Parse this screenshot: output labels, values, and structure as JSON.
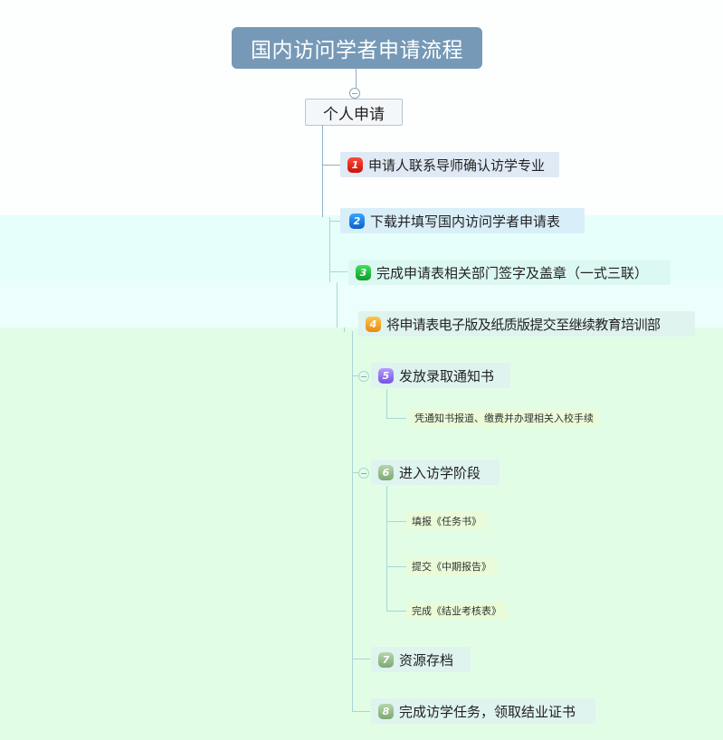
{
  "title": "国内访问学者申请流程",
  "root": "个人申请",
  "steps": [
    {
      "num": "1",
      "label": "申请人联系导师确认访学专业",
      "color": "#e51c14"
    },
    {
      "num": "2",
      "label": "下载并填写国内访问学者申请表",
      "color": "#1677e0"
    },
    {
      "num": "3",
      "label": "完成申请表相关部门签字及盖章（一式三联）",
      "color": "#1fb73d"
    },
    {
      "num": "4",
      "label": "将申请表电子版及纸质版提交至继续教育培训部",
      "color": "#f0a020"
    },
    {
      "num": "5",
      "label": "发放录取通知书",
      "color": "#8b6cf0"
    },
    {
      "num": "6",
      "label": "进入访学阶段",
      "color": "#94be88"
    },
    {
      "num": "7",
      "label": "资源存档",
      "color": "#94be88"
    },
    {
      "num": "8",
      "label": "完成访学任务，领取结业证书",
      "color": "#94be88"
    }
  ],
  "step5_children": [
    "凭通知书报道、缴费并办理相关入校手续"
  ],
  "step6_children": [
    "填报《任务书》",
    "提交《中期报告》",
    "完成《结业考核表》"
  ]
}
